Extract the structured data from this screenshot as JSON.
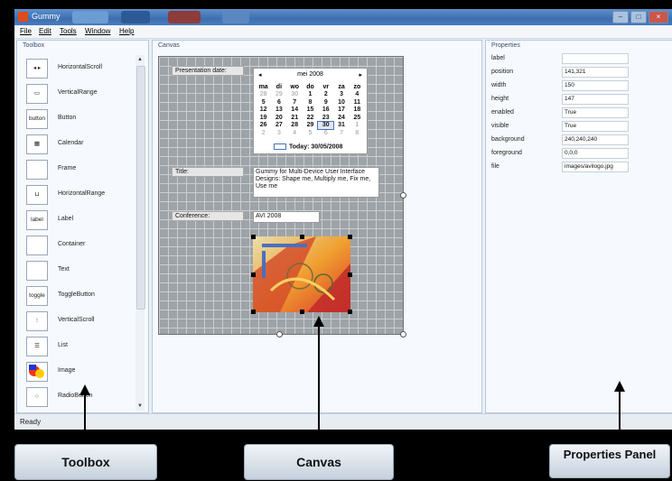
{
  "window": {
    "title": "Gummy",
    "controls": [
      "min",
      "max",
      "close"
    ]
  },
  "menu": [
    "File",
    "Edit",
    "Tools",
    "Window",
    "Help"
  ],
  "toolbox": {
    "title": "Toolbox",
    "items": [
      {
        "label": "HorizontalScroll",
        "icon_text": "◂ ▸"
      },
      {
        "label": "VerticalRange",
        "icon_text": "▭"
      },
      {
        "label": "Button",
        "icon_text": "button"
      },
      {
        "label": "Calendar",
        "icon_text": "▦"
      },
      {
        "label": "Frame",
        "icon_text": ""
      },
      {
        "label": "HorizontalRange",
        "icon_text": "⊔"
      },
      {
        "label": "Label",
        "icon_text": "label"
      },
      {
        "label": "Container",
        "icon_text": ""
      },
      {
        "label": "Text",
        "icon_text": ""
      },
      {
        "label": "ToggleButton",
        "icon_text": "toggle"
      },
      {
        "label": "VerticalScroll",
        "icon_text": "⁝"
      },
      {
        "label": "List",
        "icon_text": "☰"
      },
      {
        "label": "Image",
        "icon_text": ""
      },
      {
        "label": "RadioButton",
        "icon_text": "○"
      }
    ]
  },
  "canvas": {
    "title": "Canvas",
    "presentation_label": "Presentation date:",
    "calendar": {
      "month": "mei 2008",
      "prev": "◂",
      "next": "▸",
      "weekdays": [
        "ma",
        "di",
        "wo",
        "do",
        "vr",
        "za",
        "zo"
      ],
      "weeks": [
        [
          "28",
          "29",
          "30",
          "1",
          "2",
          "3",
          "4"
        ],
        [
          "5",
          "6",
          "7",
          "8",
          "9",
          "10",
          "11"
        ],
        [
          "12",
          "13",
          "14",
          "15",
          "16",
          "17",
          "18"
        ],
        [
          "19",
          "20",
          "21",
          "22",
          "23",
          "24",
          "25"
        ],
        [
          "26",
          "27",
          "28",
          "29",
          "30",
          "31",
          "1"
        ],
        [
          "2",
          "3",
          "4",
          "5",
          "6",
          "7",
          "8"
        ]
      ],
      "today": "Today: 30/05/2008"
    },
    "title_label": "Title:",
    "title_value": "Gummy for Multi-Device User Interface Designs: Shape me, Multiply me, Fix me, Use me",
    "conference_label": "Conference:",
    "conference_value": "AVI 2008"
  },
  "properties": {
    "title": "Properties",
    "rows": [
      {
        "name": "label",
        "value": ""
      },
      {
        "name": "position",
        "value": "141,321"
      },
      {
        "name": "width",
        "value": "150"
      },
      {
        "name": "height",
        "value": "147"
      },
      {
        "name": "enabled",
        "value": "True"
      },
      {
        "name": "visible",
        "value": "True"
      },
      {
        "name": "background",
        "value": "240,240,240"
      },
      {
        "name": "foreground",
        "value": "0,0,0"
      },
      {
        "name": "file",
        "value": "images/avilogo.jpg"
      }
    ]
  },
  "status": "Ready",
  "callouts": {
    "toolbox": "Toolbox",
    "canvas": "Canvas",
    "properties": "Properties Panel"
  }
}
